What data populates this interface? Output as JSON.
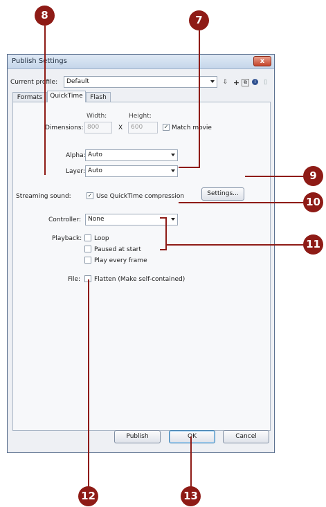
{
  "window": {
    "title": "Publish Settings",
    "close_label": "x"
  },
  "profile": {
    "label": "Current profile:",
    "value": "Default"
  },
  "tabs": [
    {
      "label": "Formats"
    },
    {
      "label": "QuickTime"
    },
    {
      "label": "Flash"
    }
  ],
  "dimensions": {
    "label": "Dimensions:",
    "width_label": "Width:",
    "height_label": "Height:",
    "width_value": "800",
    "height_value": "600",
    "x_label": "X",
    "match_movie_label": "Match movie"
  },
  "alpha": {
    "label": "Alpha:",
    "value": "Auto"
  },
  "layer": {
    "label": "Layer:",
    "value": "Auto"
  },
  "streaming": {
    "label": "Streaming sound:",
    "checkbox_label": "Use QuickTime compression",
    "settings_button": "Settings..."
  },
  "controller": {
    "label": "Controller:",
    "value": "None"
  },
  "playback": {
    "label": "Playback:",
    "options": [
      "Loop",
      "Paused at start",
      "Play every frame"
    ]
  },
  "file": {
    "label": "File:",
    "checkbox_label": "Flatten (Make self-contained)"
  },
  "buttons": {
    "publish": "Publish",
    "ok": "OK",
    "cancel": "Cancel"
  },
  "callouts": {
    "c7": "7",
    "c8": "8",
    "c9": "9",
    "c10": "10",
    "c11": "11",
    "c12": "12",
    "c13": "13"
  },
  "colors": {
    "callout": "#8e1b16",
    "titlebar": "#c5d6ea"
  }
}
